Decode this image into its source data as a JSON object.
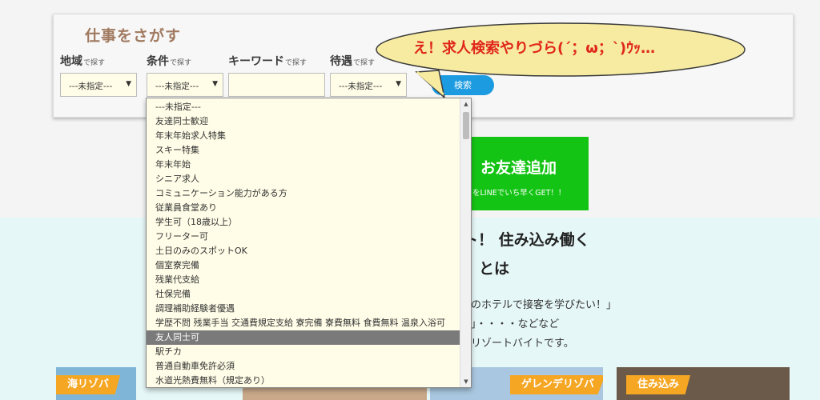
{
  "search": {
    "title": "仕事をさがす",
    "fields": [
      {
        "label": "地域",
        "suffix": "で探す",
        "value": "---未指定---"
      },
      {
        "label": "条件",
        "suffix": "で探す",
        "value": "---未指定---"
      },
      {
        "label": "キーワード",
        "suffix": "で探す",
        "value": ""
      },
      {
        "label": "待遇",
        "suffix": "で探す",
        "value": "---未指定---"
      }
    ],
    "button_label": "検索"
  },
  "bubble": {
    "text": "え！求人検索やりづら(´；ω；`)ｳｯ…"
  },
  "dropdown": {
    "options": [
      "---未指定---",
      "友達同士歓迎",
      "年末年始求人特集",
      "スキー特集",
      "年末年始",
      "シニア求人",
      "コミュニケーション能力がある方",
      "従業員食堂あり",
      "学生可（18歳以上）",
      "フリーター可",
      "土日のみのスポットOK",
      "個室寮完備",
      "残業代支給",
      "社保完備",
      "調理補助経験者優遇",
      "学歴不問 残業手当 交通費規定支給 寮完備 寮費無料 食費無料 温泉入浴可",
      "友人同士可",
      "駅チカ",
      "普通自動車免許必須",
      "水道光熱費無料（規定あり）"
    ],
    "selected_index": 16
  },
  "background": {
    "line_banner_title": "お友達追加",
    "line_banner_sub": "をLINEでいち早くGET！！",
    "heading_1": "ト！ 住み込み働く",
    "heading_2": "とは",
    "body_1": "のホテルで接客を学びたい！」",
    "body_2": "」・・・・などなど",
    "body_3": "リゾートバイトです。",
    "cards": [
      "海リゾバ",
      "ゲレンデリゾバ",
      "住み込み"
    ]
  },
  "colors": {
    "accent": "#1d9be0",
    "bubble_fill": "#f6eba0",
    "bubble_text": "#e0261b",
    "line_green": "#14c414",
    "selected_option": "#7a7a7a"
  }
}
